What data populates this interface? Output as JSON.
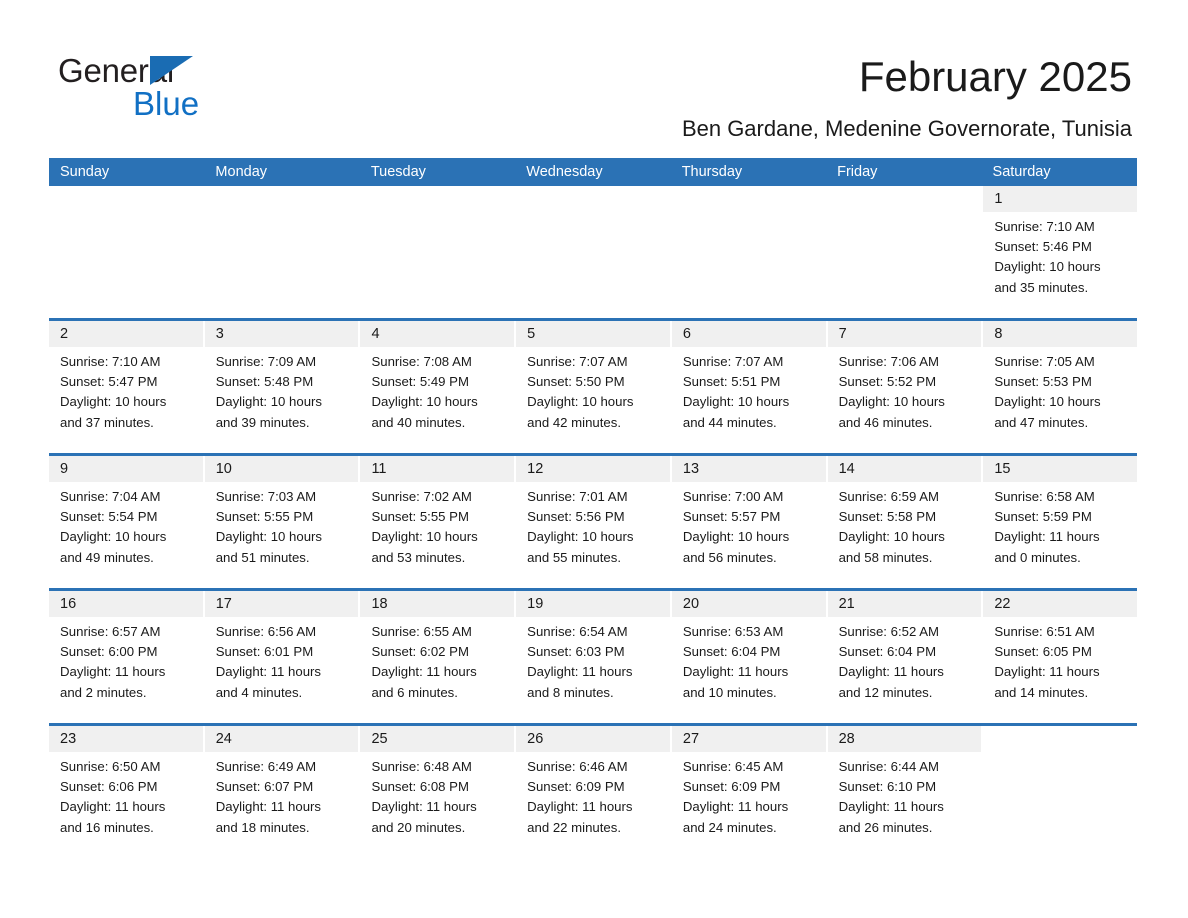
{
  "brand": {
    "name_part1": "General",
    "name_part2": "Blue",
    "triangle_color": "#1a6cb3",
    "blue_color": "#1170c4"
  },
  "header": {
    "title": "February 2025",
    "subtitle": "Ben Gardane, Medenine Governorate, Tunisia"
  },
  "theme": {
    "header_blue": "#2b72b5",
    "date_strip_gray": "#f0f0f0",
    "text_color": "#1a1a1a"
  },
  "weekday_headers": [
    "Sunday",
    "Monday",
    "Tuesday",
    "Wednesday",
    "Thursday",
    "Friday",
    "Saturday"
  ],
  "weeks": [
    {
      "days": [
        {
          "date": "",
          "blank": true,
          "sunrise": "",
          "sunset": "",
          "daylight_line1": "",
          "daylight_line2": ""
        },
        {
          "date": "",
          "blank": true,
          "sunrise": "",
          "sunset": "",
          "daylight_line1": "",
          "daylight_line2": ""
        },
        {
          "date": "",
          "blank": true,
          "sunrise": "",
          "sunset": "",
          "daylight_line1": "",
          "daylight_line2": ""
        },
        {
          "date": "",
          "blank": true,
          "sunrise": "",
          "sunset": "",
          "daylight_line1": "",
          "daylight_line2": ""
        },
        {
          "date": "",
          "blank": true,
          "sunrise": "",
          "sunset": "",
          "daylight_line1": "",
          "daylight_line2": ""
        },
        {
          "date": "",
          "blank": true,
          "sunrise": "",
          "sunset": "",
          "daylight_line1": "",
          "daylight_line2": ""
        },
        {
          "date": "1",
          "sunrise": "Sunrise: 7:10 AM",
          "sunset": "Sunset: 5:46 PM",
          "daylight_line1": "Daylight: 10 hours",
          "daylight_line2": "and 35 minutes."
        }
      ]
    },
    {
      "days": [
        {
          "date": "2",
          "sunrise": "Sunrise: 7:10 AM",
          "sunset": "Sunset: 5:47 PM",
          "daylight_line1": "Daylight: 10 hours",
          "daylight_line2": "and 37 minutes."
        },
        {
          "date": "3",
          "sunrise": "Sunrise: 7:09 AM",
          "sunset": "Sunset: 5:48 PM",
          "daylight_line1": "Daylight: 10 hours",
          "daylight_line2": "and 39 minutes."
        },
        {
          "date": "4",
          "sunrise": "Sunrise: 7:08 AM",
          "sunset": "Sunset: 5:49 PM",
          "daylight_line1": "Daylight: 10 hours",
          "daylight_line2": "and 40 minutes."
        },
        {
          "date": "5",
          "sunrise": "Sunrise: 7:07 AM",
          "sunset": "Sunset: 5:50 PM",
          "daylight_line1": "Daylight: 10 hours",
          "daylight_line2": "and 42 minutes."
        },
        {
          "date": "6",
          "sunrise": "Sunrise: 7:07 AM",
          "sunset": "Sunset: 5:51 PM",
          "daylight_line1": "Daylight: 10 hours",
          "daylight_line2": "and 44 minutes."
        },
        {
          "date": "7",
          "sunrise": "Sunrise: 7:06 AM",
          "sunset": "Sunset: 5:52 PM",
          "daylight_line1": "Daylight: 10 hours",
          "daylight_line2": "and 46 minutes."
        },
        {
          "date": "8",
          "sunrise": "Sunrise: 7:05 AM",
          "sunset": "Sunset: 5:53 PM",
          "daylight_line1": "Daylight: 10 hours",
          "daylight_line2": "and 47 minutes."
        }
      ]
    },
    {
      "days": [
        {
          "date": "9",
          "sunrise": "Sunrise: 7:04 AM",
          "sunset": "Sunset: 5:54 PM",
          "daylight_line1": "Daylight: 10 hours",
          "daylight_line2": "and 49 minutes."
        },
        {
          "date": "10",
          "sunrise": "Sunrise: 7:03 AM",
          "sunset": "Sunset: 5:55 PM",
          "daylight_line1": "Daylight: 10 hours",
          "daylight_line2": "and 51 minutes."
        },
        {
          "date": "11",
          "sunrise": "Sunrise: 7:02 AM",
          "sunset": "Sunset: 5:55 PM",
          "daylight_line1": "Daylight: 10 hours",
          "daylight_line2": "and 53 minutes."
        },
        {
          "date": "12",
          "sunrise": "Sunrise: 7:01 AM",
          "sunset": "Sunset: 5:56 PM",
          "daylight_line1": "Daylight: 10 hours",
          "daylight_line2": "and 55 minutes."
        },
        {
          "date": "13",
          "sunrise": "Sunrise: 7:00 AM",
          "sunset": "Sunset: 5:57 PM",
          "daylight_line1": "Daylight: 10 hours",
          "daylight_line2": "and 56 minutes."
        },
        {
          "date": "14",
          "sunrise": "Sunrise: 6:59 AM",
          "sunset": "Sunset: 5:58 PM",
          "daylight_line1": "Daylight: 10 hours",
          "daylight_line2": "and 58 minutes."
        },
        {
          "date": "15",
          "sunrise": "Sunrise: 6:58 AM",
          "sunset": "Sunset: 5:59 PM",
          "daylight_line1": "Daylight: 11 hours",
          "daylight_line2": "and 0 minutes."
        }
      ]
    },
    {
      "days": [
        {
          "date": "16",
          "sunrise": "Sunrise: 6:57 AM",
          "sunset": "Sunset: 6:00 PM",
          "daylight_line1": "Daylight: 11 hours",
          "daylight_line2": "and 2 minutes."
        },
        {
          "date": "17",
          "sunrise": "Sunrise: 6:56 AM",
          "sunset": "Sunset: 6:01 PM",
          "daylight_line1": "Daylight: 11 hours",
          "daylight_line2": "and 4 minutes."
        },
        {
          "date": "18",
          "sunrise": "Sunrise: 6:55 AM",
          "sunset": "Sunset: 6:02 PM",
          "daylight_line1": "Daylight: 11 hours",
          "daylight_line2": "and 6 minutes."
        },
        {
          "date": "19",
          "sunrise": "Sunrise: 6:54 AM",
          "sunset": "Sunset: 6:03 PM",
          "daylight_line1": "Daylight: 11 hours",
          "daylight_line2": "and 8 minutes."
        },
        {
          "date": "20",
          "sunrise": "Sunrise: 6:53 AM",
          "sunset": "Sunset: 6:04 PM",
          "daylight_line1": "Daylight: 11 hours",
          "daylight_line2": "and 10 minutes."
        },
        {
          "date": "21",
          "sunrise": "Sunrise: 6:52 AM",
          "sunset": "Sunset: 6:04 PM",
          "daylight_line1": "Daylight: 11 hours",
          "daylight_line2": "and 12 minutes."
        },
        {
          "date": "22",
          "sunrise": "Sunrise: 6:51 AM",
          "sunset": "Sunset: 6:05 PM",
          "daylight_line1": "Daylight: 11 hours",
          "daylight_line2": "and 14 minutes."
        }
      ]
    },
    {
      "days": [
        {
          "date": "23",
          "sunrise": "Sunrise: 6:50 AM",
          "sunset": "Sunset: 6:06 PM",
          "daylight_line1": "Daylight: 11 hours",
          "daylight_line2": "and 16 minutes."
        },
        {
          "date": "24",
          "sunrise": "Sunrise: 6:49 AM",
          "sunset": "Sunset: 6:07 PM",
          "daylight_line1": "Daylight: 11 hours",
          "daylight_line2": "and 18 minutes."
        },
        {
          "date": "25",
          "sunrise": "Sunrise: 6:48 AM",
          "sunset": "Sunset: 6:08 PM",
          "daylight_line1": "Daylight: 11 hours",
          "daylight_line2": "and 20 minutes."
        },
        {
          "date": "26",
          "sunrise": "Sunrise: 6:46 AM",
          "sunset": "Sunset: 6:09 PM",
          "daylight_line1": "Daylight: 11 hours",
          "daylight_line2": "and 22 minutes."
        },
        {
          "date": "27",
          "sunrise": "Sunrise: 6:45 AM",
          "sunset": "Sunset: 6:09 PM",
          "daylight_line1": "Daylight: 11 hours",
          "daylight_line2": "and 24 minutes."
        },
        {
          "date": "28",
          "sunrise": "Sunrise: 6:44 AM",
          "sunset": "Sunset: 6:10 PM",
          "daylight_line1": "Daylight: 11 hours",
          "daylight_line2": "and 26 minutes."
        },
        {
          "date": "",
          "blank": true,
          "sunrise": "",
          "sunset": "",
          "daylight_line1": "",
          "daylight_line2": ""
        }
      ]
    }
  ]
}
